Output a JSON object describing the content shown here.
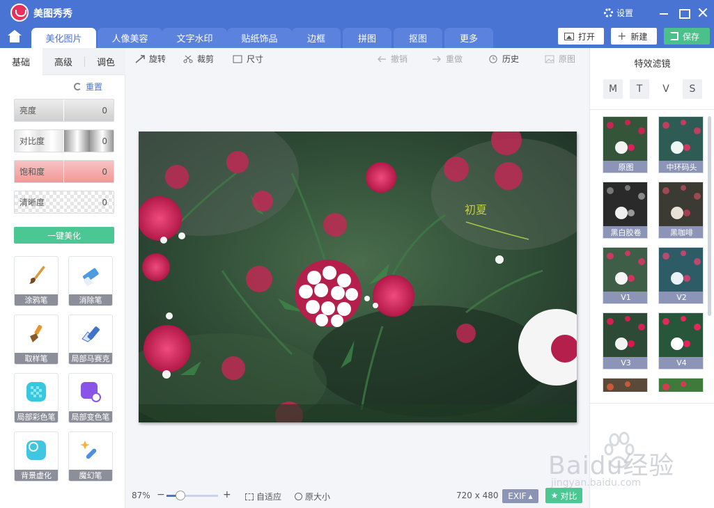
{
  "app": {
    "title": "美图秀秀",
    "settings_label": "设置"
  },
  "nav": {
    "tabs": [
      "美化图片",
      "人像美容",
      "文字水印",
      "贴纸饰品",
      "边框",
      "拼图",
      "抠图",
      "更多"
    ],
    "open_label": "打开",
    "new_label": "新建",
    "save_label": "保存"
  },
  "left_panel": {
    "subtabs": [
      "基础",
      "高级",
      "调色"
    ],
    "reset_label": "重置",
    "sliders": [
      {
        "label": "亮度",
        "value": "0"
      },
      {
        "label": "对比度",
        "value": "0"
      },
      {
        "label": "饱和度",
        "value": "0"
      },
      {
        "label": "清晰度",
        "value": "0"
      }
    ],
    "one_key_label": "一键美化",
    "tools": [
      "涂鸦笔",
      "消除笔",
      "取样笔",
      "局部马赛克",
      "局部彩色笔",
      "局部变色笔",
      "背景虚化",
      "魔幻笔"
    ]
  },
  "workbar": {
    "rotate": "旋转",
    "crop": "裁剪",
    "size": "尺寸",
    "undo": "撤销",
    "redo": "重做",
    "history": "历史",
    "original": "原图"
  },
  "photo": {
    "caption": "初夏"
  },
  "bottombar": {
    "zoom": "87%",
    "zoom_level": 0.27,
    "fit": "自适应",
    "original_size": "原大小",
    "dimensions": "720 x 480",
    "exif": "EXIF",
    "compare": "对比"
  },
  "right_panel": {
    "title": "特效滤镜",
    "filter_tabs": [
      "M",
      "T",
      "V",
      "S"
    ],
    "filters": [
      "原图",
      "中环码头",
      "黑白胶卷",
      "黑咖啡",
      "V1",
      "V2",
      "V3",
      "V4"
    ]
  },
  "watermark": {
    "brand": "Baidu经验",
    "url": "jingyan.baidu.com"
  },
  "colors": {
    "brand": "#4a74d3",
    "accent_green": "#4ac793",
    "tag_gray": "#8c95b7"
  }
}
